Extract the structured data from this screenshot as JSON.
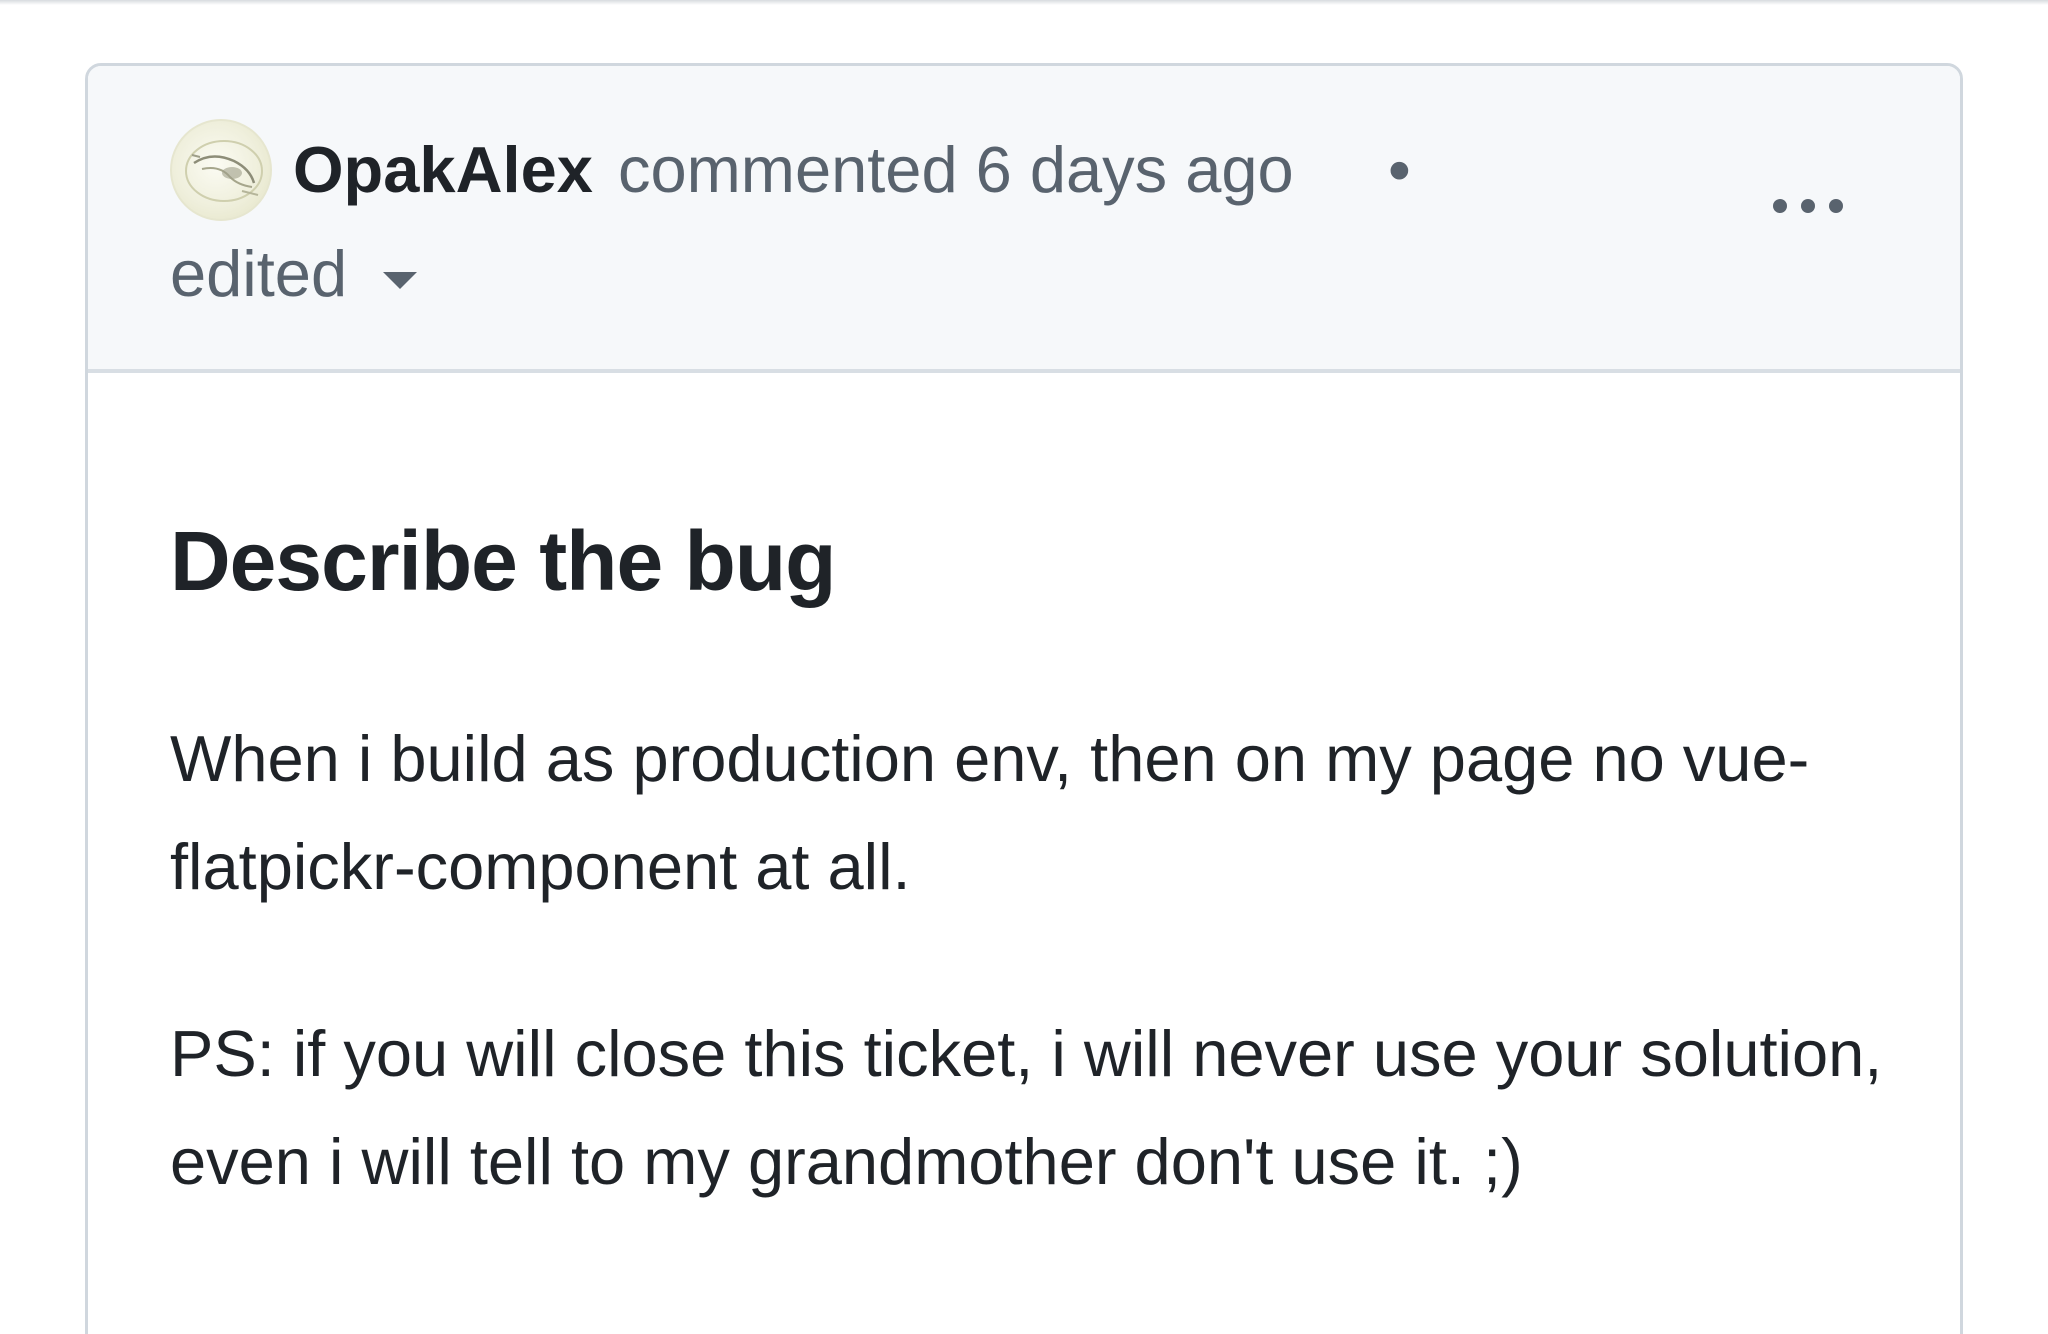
{
  "comment": {
    "author": "OpakAlex",
    "action": "commented",
    "time": "6 days ago",
    "separator": "•",
    "edited_label": "edited",
    "menu_icon": "kebab-horizontal-icon",
    "avatar_icon": "user-avatar-icon"
  },
  "body": {
    "heading": "Describe the bug",
    "paragraphs": [
      "When i build as production env, then on my page no vue-flatpickr-component at all.",
      "PS: if you will close this ticket, i will never use your solution, even i will tell to my grandmother don't use it. ;)"
    ]
  },
  "colors": {
    "header_bg": "#f6f8fa",
    "border": "#d0d7de",
    "text": "#1f2328",
    "muted": "#59636e"
  }
}
